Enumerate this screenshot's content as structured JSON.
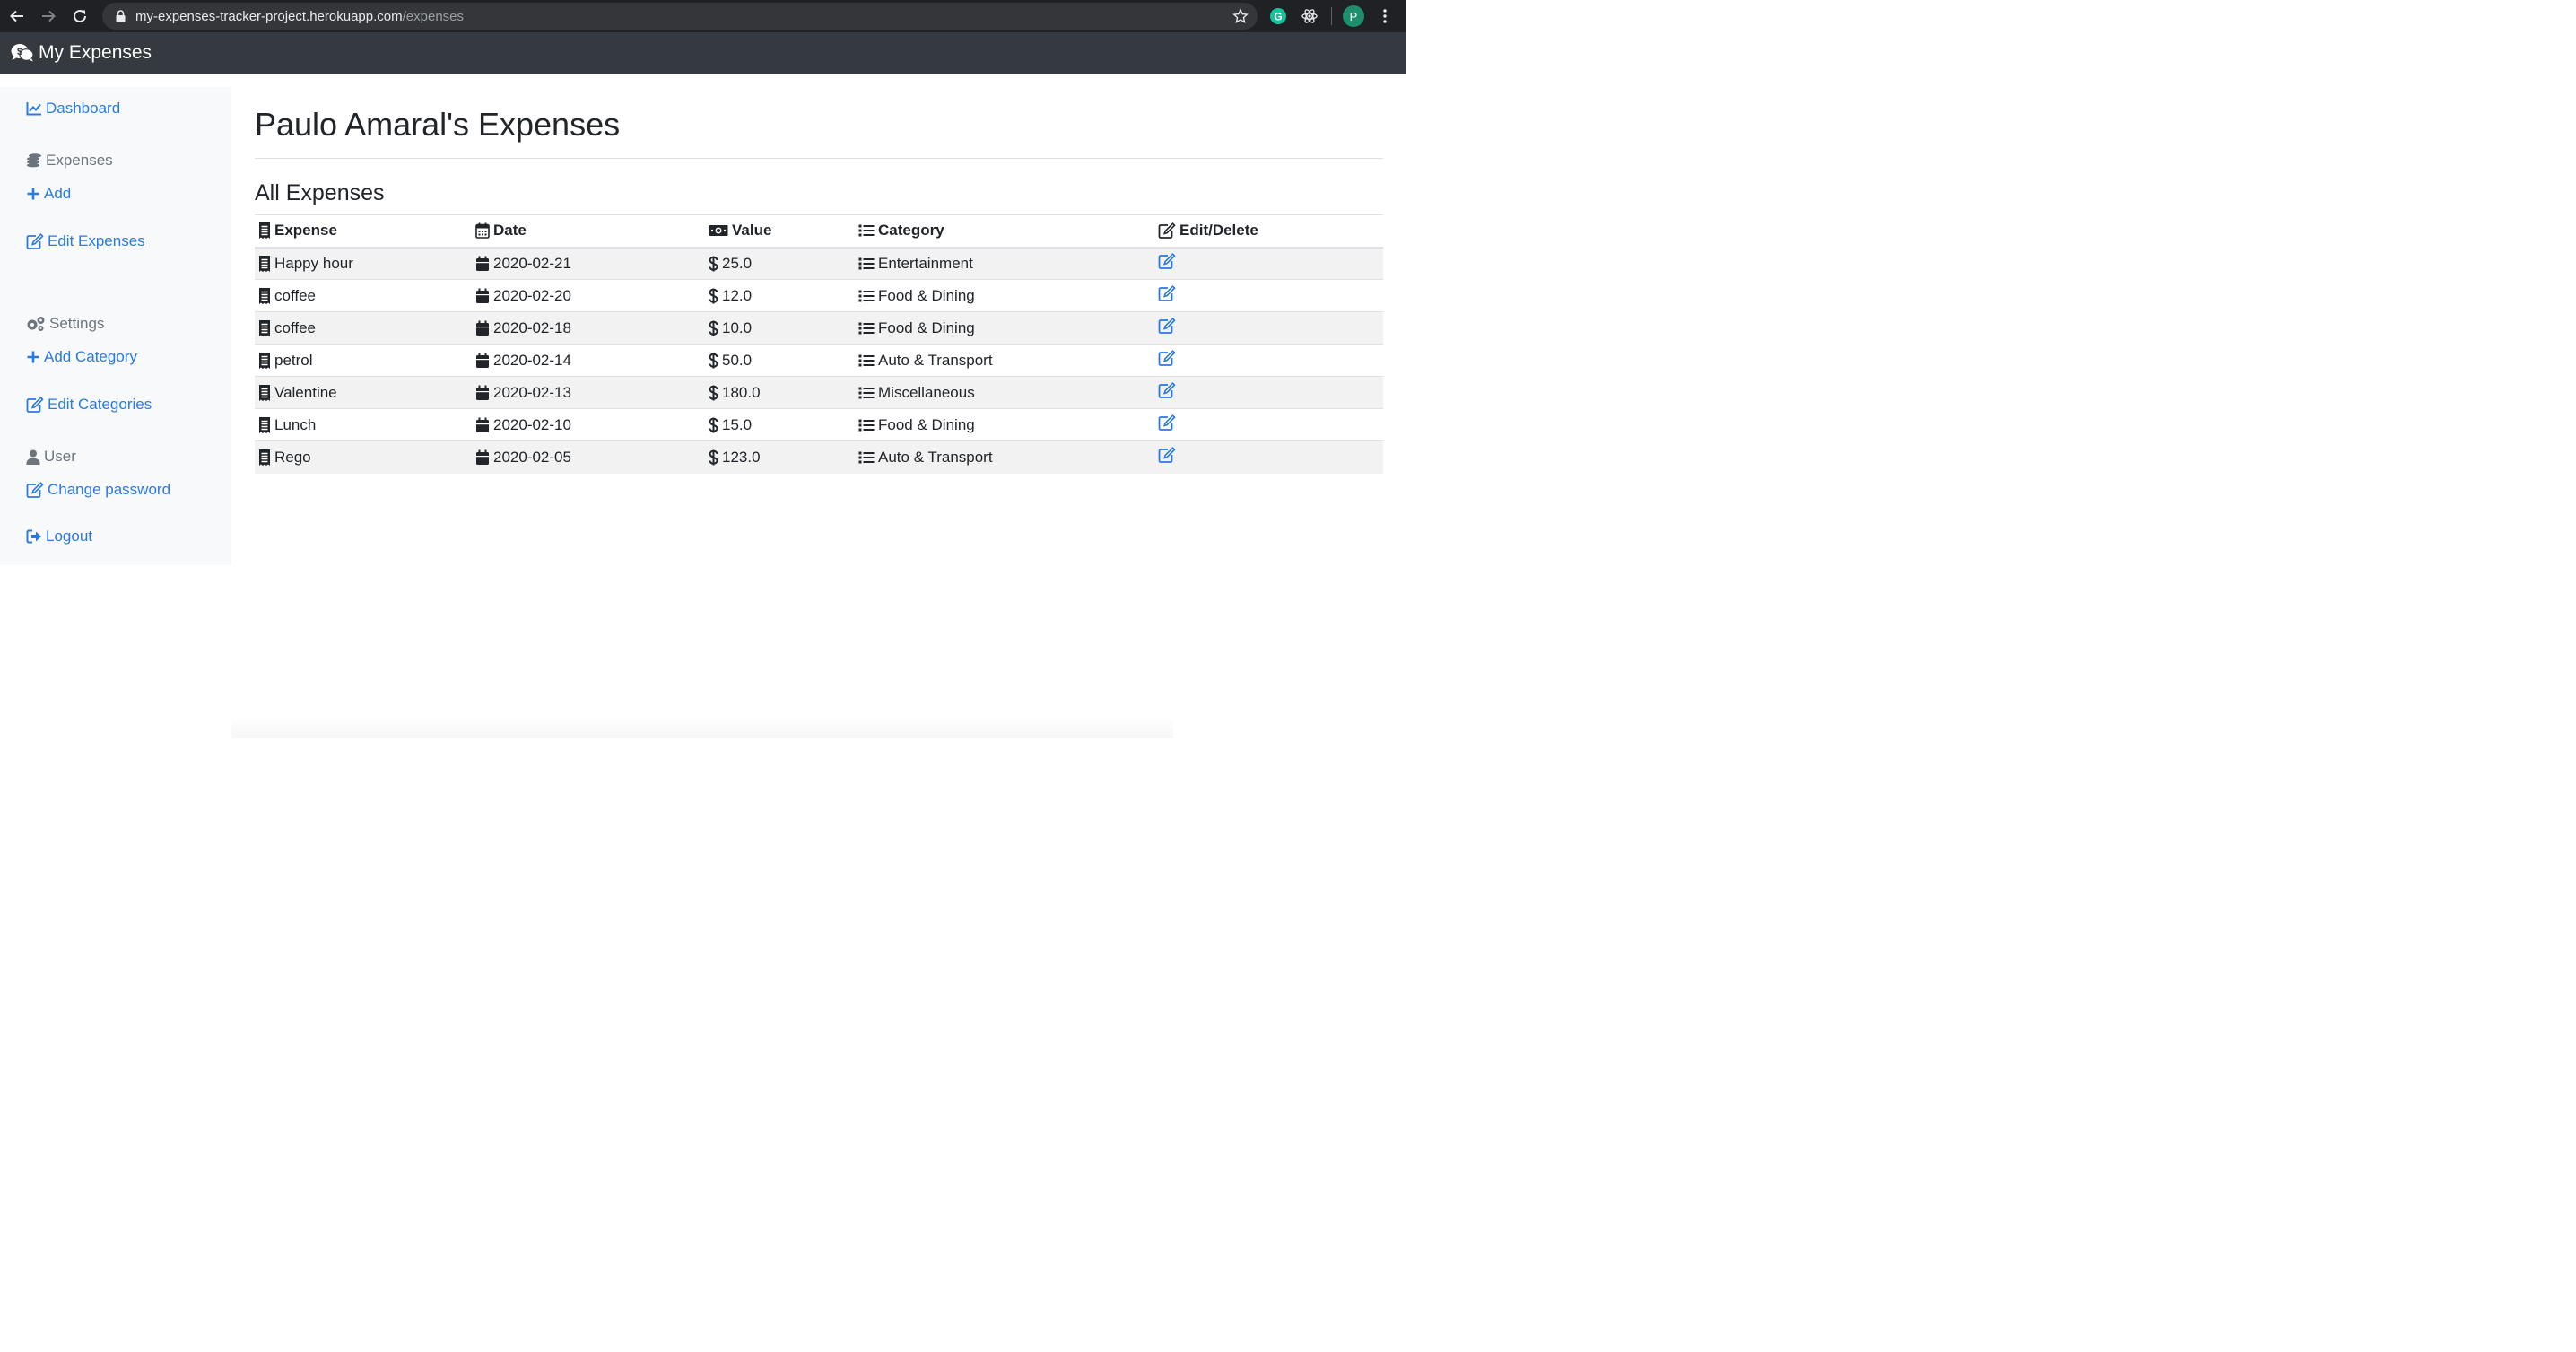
{
  "browser": {
    "url_host": "my-expenses-tracker-project.herokuapp.com",
    "url_path": "/expenses",
    "profile_initial": "P"
  },
  "navbar": {
    "brand": "My Expenses"
  },
  "sidebar": {
    "dashboard": "Dashboard",
    "expenses_heading": "Expenses",
    "add": "Add",
    "edit_expenses": "Edit Expenses",
    "settings_heading": "Settings",
    "add_category": "Add Category",
    "edit_categories": "Edit Categories",
    "user_heading": "User",
    "change_password": "Change password",
    "logout": "Logout"
  },
  "main": {
    "title": "Paulo Amaral's Expenses",
    "section_title": "All Expenses",
    "columns": [
      "Expense",
      "Date",
      "Value",
      "Category",
      "Edit/Delete"
    ],
    "rows": [
      {
        "expense": "Happy hour",
        "date": "2020-02-21",
        "value": "25.0",
        "category": "Entertainment"
      },
      {
        "expense": "coffee",
        "date": "2020-02-20",
        "value": "12.0",
        "category": "Food & Dining"
      },
      {
        "expense": "coffee",
        "date": "2020-02-18",
        "value": "10.0",
        "category": "Food & Dining"
      },
      {
        "expense": "petrol",
        "date": "2020-02-14",
        "value": "50.0",
        "category": "Auto & Transport"
      },
      {
        "expense": "Valentine",
        "date": "2020-02-13",
        "value": "180.0",
        "category": "Miscellaneous"
      },
      {
        "expense": "Lunch",
        "date": "2020-02-10",
        "value": "15.0",
        "category": "Food & Dining"
      },
      {
        "expense": "Rego",
        "date": "2020-02-05",
        "value": "123.0",
        "category": "Auto & Transport"
      }
    ]
  },
  "colors": {
    "link": "#2a7ae2",
    "navbar": "#343a40",
    "sidebar": "#f8f9fa",
    "browser_chrome": "#202124"
  }
}
